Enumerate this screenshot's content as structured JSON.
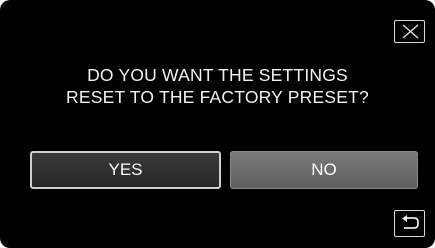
{
  "dialog": {
    "message_line1": "DO YOU WANT THE SETTINGS",
    "message_line2": "RESET TO THE FACTORY PRESET?",
    "yes_label": "YES",
    "no_label": "NO",
    "close_icon": "close-icon",
    "back_icon": "return-arrow-icon"
  },
  "colors": {
    "background": "#000000",
    "text": "#ffffff",
    "yes_button_bg": "#2f2f2f",
    "no_button_bg": "#6b6b6b",
    "border": "#d8d8d8"
  }
}
